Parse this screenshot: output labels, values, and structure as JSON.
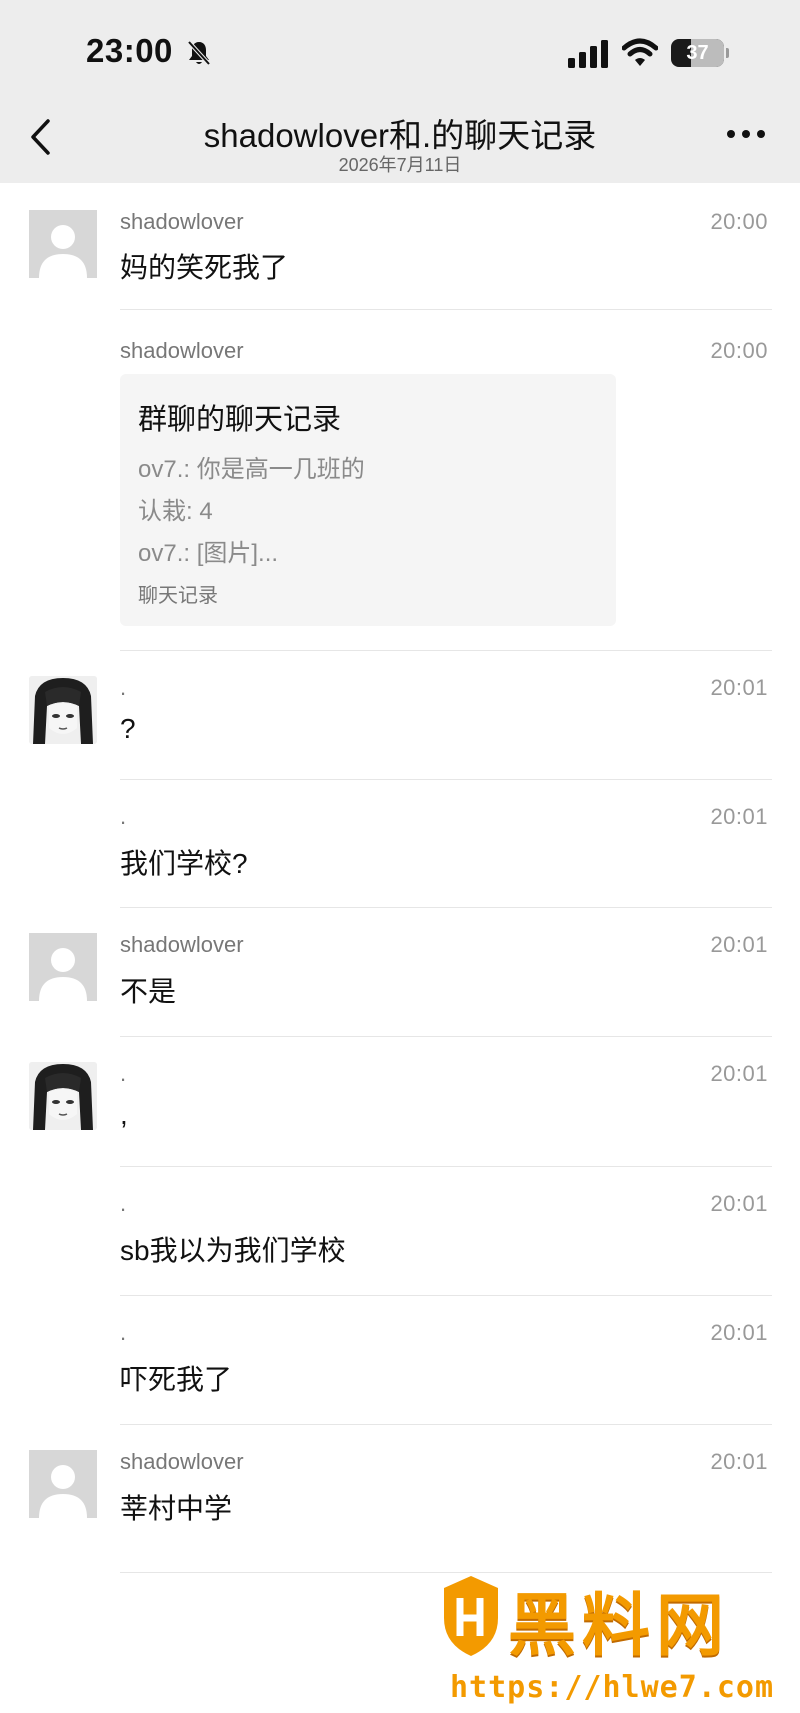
{
  "status_bar": {
    "time": "23:00",
    "battery_level": 37,
    "battery_label": "37"
  },
  "nav": {
    "title": "shadowlover和.的聊天记录",
    "subtitle": "2026年7月11日"
  },
  "messages": [
    {
      "sender": "shadowlover",
      "time": "20:00",
      "text": "妈的笑死我了",
      "avatar": "placeholder"
    },
    {
      "sender": "shadowlover",
      "time": "20:00",
      "card": {
        "title": "群聊的聊天记录",
        "lines": [
          "ov7.: 你是高一几班的",
          "认栽: 4",
          "ov7.: [图片]..."
        ],
        "footer": "聊天记录"
      }
    },
    {
      "sender": ".",
      "time": "20:01",
      "text": "?",
      "avatar": "anime"
    },
    {
      "sender": ".",
      "time": "20:01",
      "text": "我们学校?"
    },
    {
      "sender": "shadowlover",
      "time": "20:01",
      "text": "不是",
      "avatar": "placeholder"
    },
    {
      "sender": ".",
      "time": "20:01",
      "text": ",",
      "avatar": "anime"
    },
    {
      "sender": ".",
      "time": "20:01",
      "text": "sb我以为我们学校"
    },
    {
      "sender": ".",
      "time": "20:01",
      "text": "吓死我了"
    },
    {
      "sender": "shadowlover",
      "time": "20:01",
      "text": "莘村中学",
      "avatar": "placeholder"
    }
  ],
  "watermark": {
    "text": "黑料网",
    "url": "https://hlwe7.com"
  },
  "colors": {
    "header_bg": "#ededed",
    "watermark_orange": "#f39a00"
  }
}
